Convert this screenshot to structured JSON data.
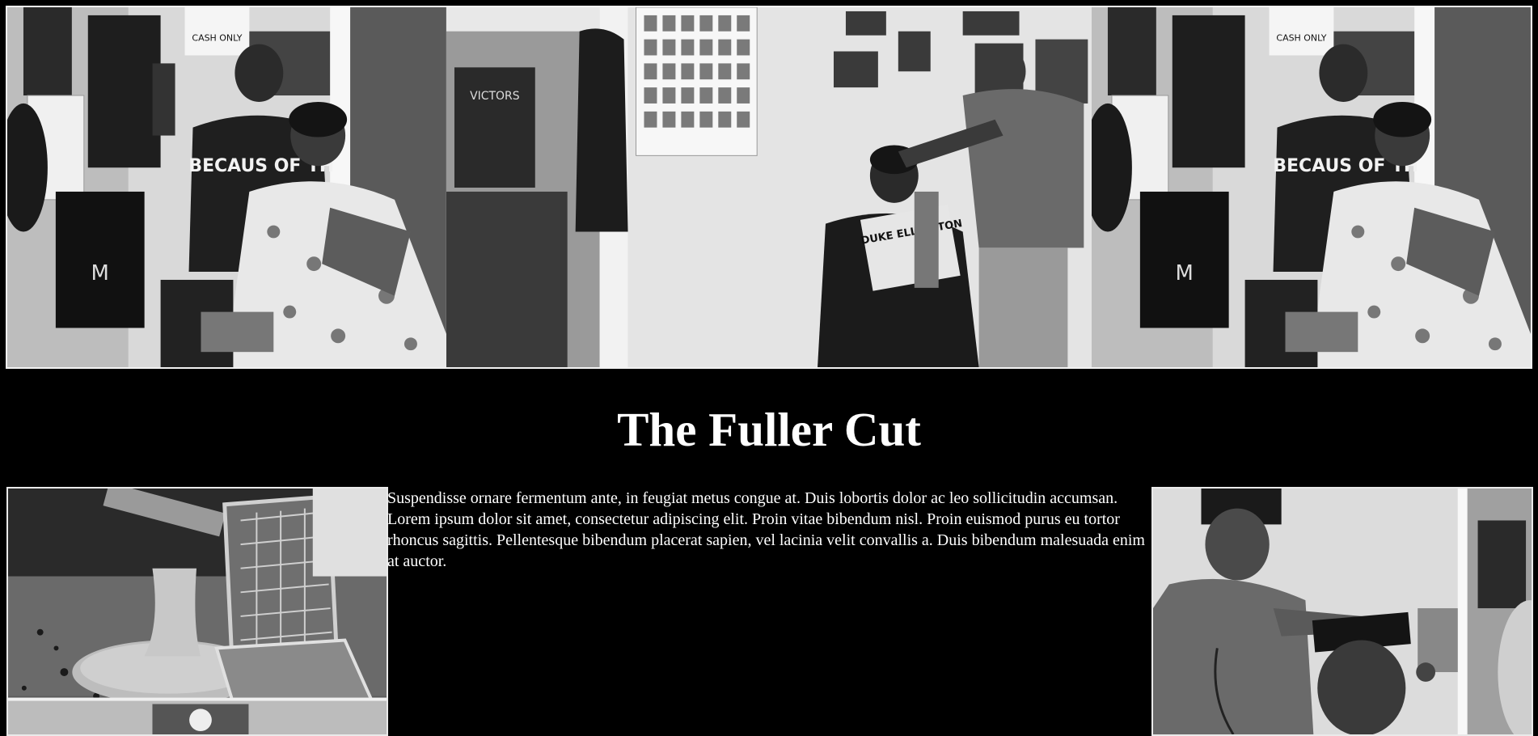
{
  "page": {
    "title": "The Fuller Cut",
    "body_text": "Suspendisse ornare fermentum ante, in feugiat metus congue at. Duis lobortis dolor ac leo sollicitudin accumsan. Lorem ipsum dolor sit amet, consectetur adipiscing elit. Proin vitae bibendum nisl. Proin euismod purus eu tortor rhoncus sagittis. Pellentesque bibendum placerat sapien, vel lacinia velit convallis a. Duis bibendum malesuada enim at auctor."
  },
  "hero": {
    "photos": [
      {
        "subject": "barber-cutting-boy-hair-photo",
        "sign_text": "CASH ONLY",
        "shirt_text": "BECAUS OF TH",
        "poster_text": "M"
      },
      {
        "subject": "barber-cutting-boy-reading-photo",
        "book_text": "DUKE ELLINGTON",
        "poster_text": "VICTORS"
      },
      {
        "subject": "barber-cutting-boy-hair-photo-repeat",
        "sign_text": "CASH ONLY",
        "shirt_text": "BECAUS OF TH",
        "poster_text": "M"
      }
    ]
  },
  "gallery": {
    "left_subject": "barber-chair-footrest-photo",
    "right_subject": "barber-trimming-customer-photo"
  },
  "colors": {
    "background": "#000000",
    "text": "#ffffff",
    "photo_border": "#eeeeee"
  }
}
